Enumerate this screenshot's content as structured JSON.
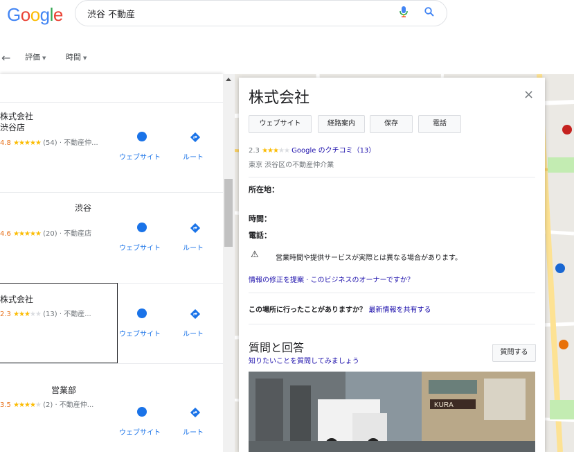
{
  "header": {
    "logo_letters": [
      {
        "ch": "G",
        "color": "#4285F4"
      },
      {
        "ch": "o",
        "color": "#EA4335"
      },
      {
        "ch": "o",
        "color": "#FBBC05"
      },
      {
        "ch": "g",
        "color": "#4285F4"
      },
      {
        "ch": "l",
        "color": "#34A853"
      },
      {
        "ch": "e",
        "color": "#EA4335"
      }
    ],
    "search_query": "渋谷 不動産",
    "mic_icon": "mic-icon",
    "search_icon": "search-icon"
  },
  "filters": {
    "back_icon": "←",
    "items": [
      {
        "label": "評価",
        "caret": "▼"
      },
      {
        "label": "時間",
        "caret": "▼"
      }
    ]
  },
  "results": [
    {
      "title_lines": [
        "株式会社",
        "渋谷店"
      ],
      "rating": "4.8",
      "stars": "★★★★★",
      "stars_off": "",
      "meta": "(54) · 不動産仲..."
    },
    {
      "title_lines": [
        "渋谷"
      ],
      "rating": "4.6",
      "stars": "★★★★★",
      "stars_off": "",
      "meta": "(20) · 不動産店"
    },
    {
      "title_lines": [
        "株式会社"
      ],
      "rating": "2.3",
      "stars": "★★★",
      "stars_off": "★★",
      "meta": "(13) · 不動産..."
    },
    {
      "title_lines": [
        "営業部"
      ],
      "rating": "3.5",
      "stars": "★★★★",
      "stars_off": "★",
      "meta": "(2) · 不動産仲..."
    }
  ],
  "result_actions": {
    "website": "ウェブサイト",
    "route": "ルート"
  },
  "detail": {
    "title": "株式会社",
    "close": "×",
    "buttons": [
      "ウェブサイト",
      "経路案内",
      "保存",
      "電話"
    ],
    "rating": "2.3",
    "stars_on": "★★★",
    "stars_off": "★★",
    "review_link": "Google のクチコミ（13）",
    "type": "東京 渋谷区の不動産仲介業",
    "address_label": "所在地：",
    "hours_label": "時間：",
    "phone_label": "電話：",
    "warning_icon": "⚠",
    "warning": "営業時間や提供サービスが実際とは異なる場合があります。",
    "edit_link": "情報の修正を提案 · このビジネスのオーナーですか？",
    "visited_q": "この場所に行ったことがありますか？",
    "visited_link": "最新情報を共有する",
    "qa_title": "質問と回答",
    "qa_sub": "知りたいことを質問してみましょう",
    "ask_button": "質問する"
  },
  "photo_sign": "KURA",
  "colors": {
    "link": "#1a0dab",
    "action_blue": "#1a73e8",
    "star": "#fbbc04",
    "rating_num": "#e7711b"
  }
}
